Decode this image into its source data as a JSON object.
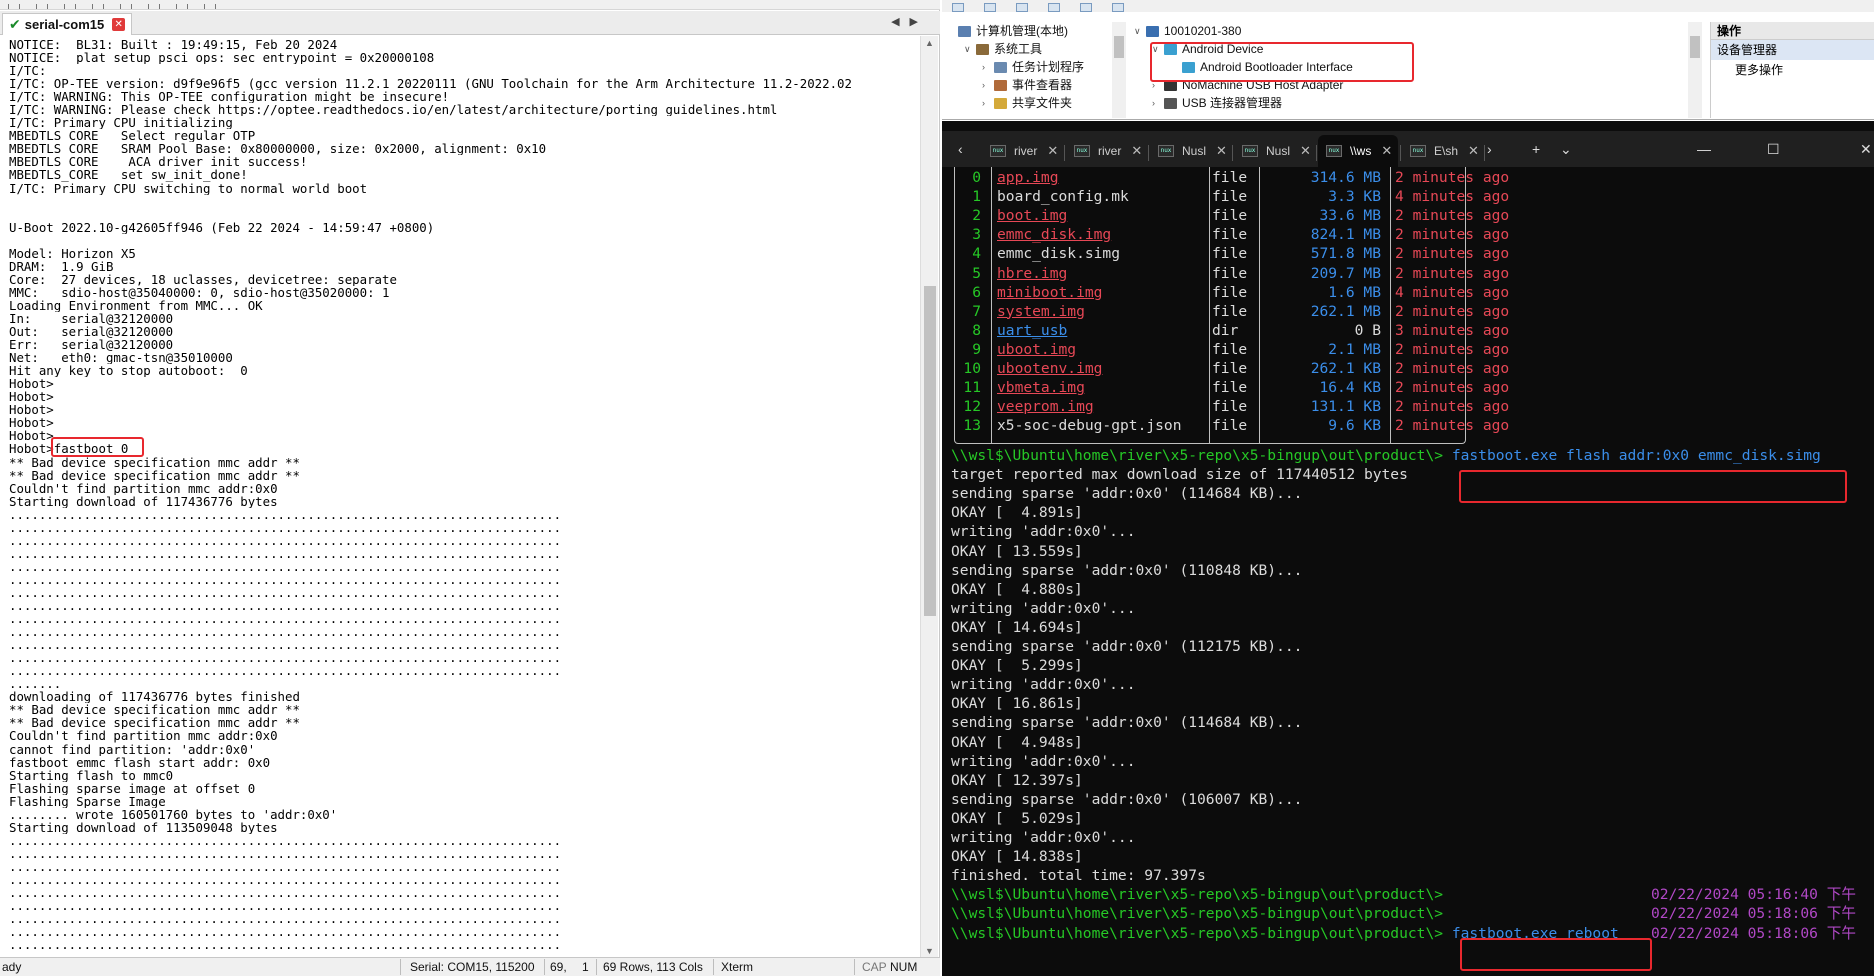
{
  "serial": {
    "tab_label": "serial-com15",
    "lines": [
      "NOTICE:  BL31: Built : 19:49:15, Feb 20 2024",
      "NOTICE:  plat_setup_psci_ops: sec_entrypoint = 0x20000108",
      "I/TC:",
      "I/TC: OP-TEE version: d9f9e96f5 (gcc version 11.2.1 20220111 (GNU Toolchain for the Arm Architecture 11.2-2022.02",
      "I/TC: WARNING: This OP-TEE configuration might be insecure!",
      "I/TC: WARNING: Please check https://optee.readthedocs.io/en/latest/architecture/porting_guidelines.html",
      "I/TC: Primary CPU initializing",
      "MBEDTLS_CORE   Select regular OTP",
      "MBEDTLS_CORE   SRAM Pool Base: 0x80000000, size: 0x2000, alignment: 0x10",
      "MBEDTLS_CORE    ACA driver init success!",
      "MBEDTLS_CORE   set sw_init_done!",
      "I/TC: Primary CPU switching to normal world boot",
      "",
      "",
      "U-Boot 2022.10-g42605ff946 (Feb 22 2024 - 14:59:47 +0800)",
      "",
      "Model: Horizon X5",
      "DRAM:  1.9 GiB",
      "Core:  27 devices, 18 uclasses, devicetree: separate",
      "MMC:   sdio-host@35040000: 0, sdio-host@35020000: 1",
      "Loading Environment from MMC... OK",
      "In:    serial@32120000",
      "Out:   serial@32120000",
      "Err:   serial@32120000",
      "Net:   eth0: gmac-tsn@35010000",
      "Hit any key to stop autoboot:  0",
      "Hobot>",
      "Hobot>",
      "Hobot>",
      "Hobot>",
      "Hobot>",
      "Hobot>fastboot 0",
      "** Bad device specification mmc addr **",
      "** Bad device specification mmc addr **",
      "Couldn't find partition mmc addr:0x0",
      "Starting download of 117436776 bytes",
      "..........................................................................",
      "..........................................................................",
      "..........................................................................",
      "..........................................................................",
      "..........................................................................",
      "..........................................................................",
      "..........................................................................",
      "..........................................................................",
      "..........................................................................",
      "..........................................................................",
      "..........................................................................",
      "..........................................................................",
      "..........................................................................",
      ".......",
      "downloading of 117436776 bytes finished",
      "** Bad device specification mmc addr **",
      "** Bad device specification mmc addr **",
      "Couldn't find partition mmc addr:0x0",
      "cannot find partition: 'addr:0x0'",
      "fastboot emmc flash start_addr: 0x0",
      "Starting flash to mmc0",
      "Flashing sparse image at offset 0",
      "Flashing Sparse Image",
      "........ wrote 160501760 bytes to 'addr:0x0'",
      "Starting download of 113509048 bytes",
      "..........................................................................",
      "..........................................................................",
      "..........................................................................",
      "..........................................................................",
      "..........................................................................",
      "..........................................................................",
      "..........................................................................",
      "..........................................................................",
      "..........................................................................",
      "..........................................................................",
      ".........................................................................."
    ]
  },
  "statusbar": {
    "ready": "ady",
    "serial": "Serial: COM15, 115200",
    "row": "69,",
    "col": "1",
    "rows_cols": "69 Rows, 113 Cols",
    "term": "Xterm",
    "caps": "CAP",
    "num": "NUM"
  },
  "device_manager": {
    "tree": [
      {
        "label": "计算机管理(本地)",
        "twisty": "",
        "indent": 0,
        "icon_color": "#5a7fb0"
      },
      {
        "label": "系统工具",
        "twisty": "∨",
        "indent": 1,
        "icon_color": "#8a6a3a"
      },
      {
        "label": "任务计划程序",
        "twisty": "›",
        "indent": 2,
        "icon_color": "#6a8ab0"
      },
      {
        "label": "事件查看器",
        "twisty": "›",
        "indent": 2,
        "icon_color": "#b06a3a"
      },
      {
        "label": "共享文件夹",
        "twisty": "›",
        "indent": 2,
        "icon_color": "#d4a93a"
      }
    ],
    "devices": [
      {
        "label": "10010201-380",
        "twisty": "∨",
        "indent": 0,
        "icon_color": "#3a6fb0"
      },
      {
        "label": "Android Device",
        "twisty": "∨",
        "indent": 1,
        "icon_color": "#3aa0d0"
      },
      {
        "label": "Android Bootloader Interface",
        "twisty": "",
        "indent": 2,
        "icon_color": "#3aa0d0"
      },
      {
        "label": "NoMachine USB Host Adapter",
        "twisty": "›",
        "indent": 1,
        "icon_color": "#333333"
      },
      {
        "label": "USB 连接器管理器",
        "twisty": "›",
        "indent": 1,
        "icon_color": "#555555"
      }
    ],
    "actions_header": "操作",
    "actions_item": "设备管理器",
    "actions_more": "更多操作"
  },
  "terminal": {
    "tabs": [
      "river",
      "river",
      "Nusl",
      "Nusl",
      "\\\\ws",
      "E\\sh"
    ],
    "active_tab": 4,
    "files": [
      {
        "idx": "0",
        "name": "app.img",
        "type": "file",
        "size": "314.6 MB",
        "modified": "2 minutes ago",
        "style": "red"
      },
      {
        "idx": "1",
        "name": "board_config.mk",
        "type": "file",
        "size": "3.3 KB",
        "modified": "4 minutes ago",
        "style": "white"
      },
      {
        "idx": "2",
        "name": "boot.img",
        "type": "file",
        "size": "33.6 MB",
        "modified": "2 minutes ago",
        "style": "red"
      },
      {
        "idx": "3",
        "name": "emmc_disk.img",
        "type": "file",
        "size": "824.1 MB",
        "modified": "2 minutes ago",
        "style": "red"
      },
      {
        "idx": "4",
        "name": "emmc_disk.simg",
        "type": "file",
        "size": "571.8 MB",
        "modified": "2 minutes ago",
        "style": "white"
      },
      {
        "idx": "5",
        "name": "hbre.img",
        "type": "file",
        "size": "209.7 MB",
        "modified": "2 minutes ago",
        "style": "red"
      },
      {
        "idx": "6",
        "name": "miniboot.img",
        "type": "file",
        "size": "1.6 MB",
        "modified": "4 minutes ago",
        "style": "red"
      },
      {
        "idx": "7",
        "name": "system.img",
        "type": "file",
        "size": "262.1 MB",
        "modified": "2 minutes ago",
        "style": "red"
      },
      {
        "idx": "8",
        "name": "uart_usb",
        "type": "dir",
        "size": "0 B",
        "modified": "3 minutes ago",
        "style": "blue"
      },
      {
        "idx": "9",
        "name": "uboot.img",
        "type": "file",
        "size": "2.1 MB",
        "modified": "2 minutes ago",
        "style": "red"
      },
      {
        "idx": "10",
        "name": "ubootenv.img",
        "type": "file",
        "size": "262.1 KB",
        "modified": "2 minutes ago",
        "style": "red"
      },
      {
        "idx": "11",
        "name": "vbmeta.img",
        "type": "file",
        "size": "16.4 KB",
        "modified": "2 minutes ago",
        "style": "red"
      },
      {
        "idx": "12",
        "name": "veeprom.img",
        "type": "file",
        "size": "131.1 KB",
        "modified": "2 minutes ago",
        "style": "red"
      },
      {
        "idx": "13",
        "name": "x5-soc-debug-gpt.json",
        "type": "file",
        "size": "9.6 KB",
        "modified": "2 minutes ago",
        "style": "white"
      }
    ],
    "prompt": "\\\\wsl$\\Ubuntu\\home\\river\\x5-repo\\x5-bingup\\out\\product\\>",
    "flash_cmd": "fastboot.exe flash addr:0x0 emmc_disk.simg",
    "output": [
      "target reported max download size of 117440512 bytes",
      "sending sparse 'addr:0x0' (114684 KB)...",
      "OKAY [  4.891s]",
      "writing 'addr:0x0'...",
      "OKAY [ 13.559s]",
      "sending sparse 'addr:0x0' (110848 KB)...",
      "OKAY [  4.880s]",
      "writing 'addr:0x0'...",
      "OKAY [ 14.694s]",
      "sending sparse 'addr:0x0' (112175 KB)...",
      "OKAY [  5.299s]",
      "writing 'addr:0x0'...",
      "OKAY [ 16.861s]",
      "sending sparse 'addr:0x0' (114684 KB)...",
      "OKAY [  4.948s]",
      "writing 'addr:0x0'...",
      "OKAY [ 12.397s]",
      "sending sparse 'addr:0x0' (106007 KB)...",
      "OKAY [  5.029s]",
      "writing 'addr:0x0'...",
      "OKAY [ 14.838s]",
      "finished. total time: 97.397s"
    ],
    "timestamps": [
      "02/22/2024 05:16:40 下午",
      "02/22/2024 05:18:06 下午",
      "02/22/2024 05:18:06 下午"
    ],
    "reboot_cmd": "fastboot.exe reboot"
  }
}
